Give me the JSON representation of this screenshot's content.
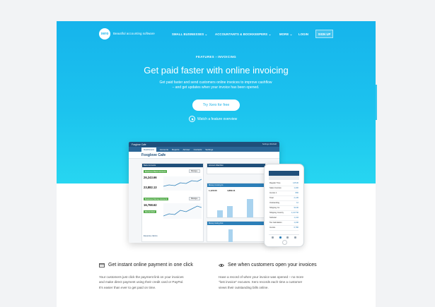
{
  "nav": {
    "logo": "xero",
    "tagline": "Beautiful accounting software",
    "items": [
      "SMALL BUSINESSES ⌄",
      "ACCOUNTANTS & BOOKKEEPERS ⌄",
      "MORE ⌄",
      "LOGIN"
    ],
    "signup": "SIGN UP"
  },
  "hero": {
    "breadcrumb": "FEATURES  ›  INVOICING",
    "headline": "Get paid faster with online invoicing",
    "subhead_lines": [
      "Get paid faster and send customers online invoices to improve cashflow",
      "– and get updates when your invoice has been opened."
    ],
    "cta": "Try Xero for free",
    "video_link": "Watch a feature overview"
  },
  "dashboard": {
    "org": "Foxglove Cafe",
    "user": "Settings Wenfield",
    "tabs": [
      "Dashboard",
      "Accounts",
      "Reports",
      "Adviser",
      "Contacts",
      "Settings"
    ],
    "title": "Foxglove Cafe",
    "bank_header": "Bank Accounts",
    "acct1": "Business Bank Account",
    "acct1_amt": "26,243.66",
    "acct1_amt2": "23,882.13",
    "acct2": "Business Money Account",
    "acct2_amt": "16,768.62",
    "reconcile": "Reconciled",
    "manage": "Manage ›",
    "watchlist": "Account Watchlist",
    "money_coming": "Money Coming In",
    "money_going": "Money Going Out",
    "val1": "1,120.00",
    "val2": "4,889.11",
    "expense_claims": "Expense claims"
  },
  "phone": {
    "rows": [
      [
        "Regular Time",
        "145.00"
      ],
      [
        "Sales Invoices",
        "1,200"
      ],
      [
        "Invoice 1",
        "800"
      ],
      [
        "Total",
        "2,145"
      ],
      [
        "Outstanding",
        "12"
      ],
      [
        "Shipping Co",
        "94.90"
      ],
      [
        "Shipping Country",
        "1,147.50"
      ],
      [
        "Subtotal",
        "1,144"
      ],
      [
        "Tax Calculation",
        "1,440"
      ],
      [
        "Invoice",
        "6,780"
      ]
    ]
  },
  "features": [
    {
      "icon": "payment-card-icon",
      "title": "Get instant online payment in one click",
      "body": [
        "Your customers just click the payment link on your invoices",
        "and make direct payment using their credit card or PayPal.",
        "It's easier than ever to get paid on time."
      ]
    },
    {
      "icon": "eye-icon",
      "title": "See when customers open your invoices",
      "body": [
        "Have a record of when your invoice was opened – no more",
        "\"lost invoice\" excuses. Xero records each time a customer",
        "views their outstanding bills online."
      ]
    }
  ],
  "colors": {
    "brand": "#13b5ea",
    "accent_dark": "#1f4f7a",
    "green": "#56ad4d"
  }
}
